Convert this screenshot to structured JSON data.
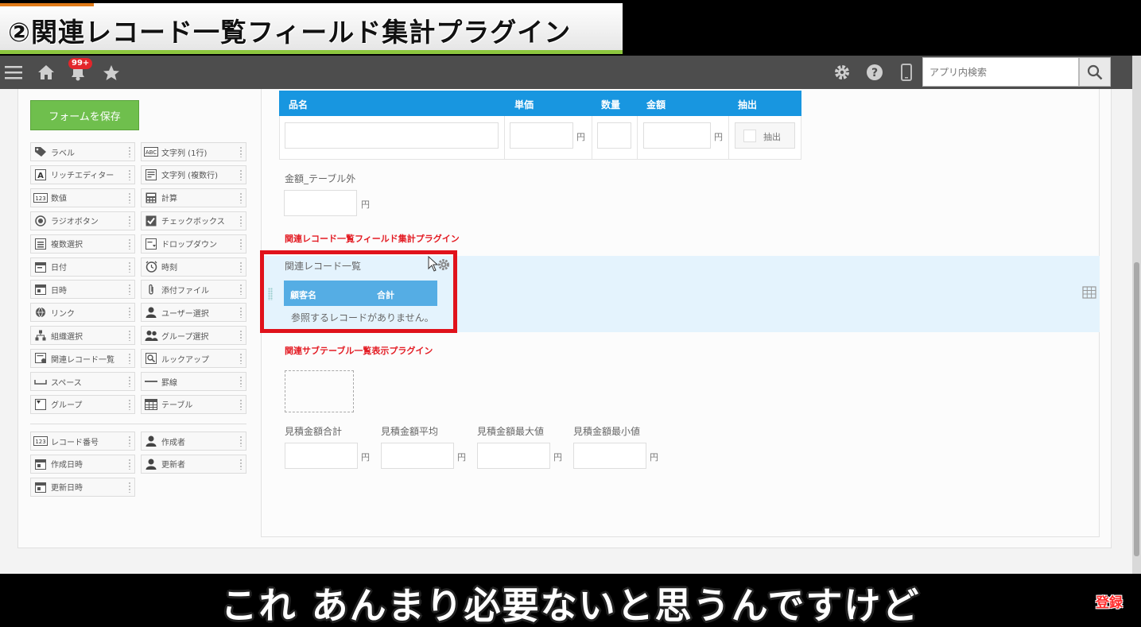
{
  "banner": {
    "title": "②関連レコード一覧フィールド集計プラグイン"
  },
  "navbar": {
    "badge": "99+",
    "search_placeholder": "アプリ内検索"
  },
  "palette": {
    "save_label": "フォームを保存",
    "left": [
      {
        "label": "ラベル",
        "icon": "tag-icon"
      },
      {
        "label": "リッチエディター",
        "icon": "rich-editor-icon"
      },
      {
        "label": "数値",
        "icon": "number-icon"
      },
      {
        "label": "ラジオボタン",
        "icon": "radio-icon"
      },
      {
        "label": "複数選択",
        "icon": "multi-select-icon"
      },
      {
        "label": "日付",
        "icon": "date-icon"
      },
      {
        "label": "日時",
        "icon": "datetime-icon"
      },
      {
        "label": "リンク",
        "icon": "link-icon"
      },
      {
        "label": "組織選択",
        "icon": "org-icon"
      },
      {
        "label": "関連レコード一覧",
        "icon": "related-records-icon"
      },
      {
        "label": "スペース",
        "icon": "space-icon"
      },
      {
        "label": "グループ",
        "icon": "group-icon"
      }
    ],
    "right": [
      {
        "label": "文字列 (1行)",
        "icon": "text-single-icon"
      },
      {
        "label": "文字列 (複数行)",
        "icon": "text-multi-icon"
      },
      {
        "label": "計算",
        "icon": "calc-icon"
      },
      {
        "label": "チェックボックス",
        "icon": "checkbox-icon"
      },
      {
        "label": "ドロップダウン",
        "icon": "dropdown-icon"
      },
      {
        "label": "時刻",
        "icon": "clock-icon"
      },
      {
        "label": "添付ファイル",
        "icon": "attachment-icon"
      },
      {
        "label": "ユーザー選択",
        "icon": "user-icon"
      },
      {
        "label": "グループ選択",
        "icon": "group-select-icon"
      },
      {
        "label": "ルックアップ",
        "icon": "lookup-icon"
      },
      {
        "label": "罫線",
        "icon": "line-icon"
      },
      {
        "label": "テーブル",
        "icon": "table-icon"
      }
    ],
    "system_left": [
      {
        "label": "レコード番号",
        "icon": "record-number-icon"
      },
      {
        "label": "作成日時",
        "icon": "created-at-icon"
      },
      {
        "label": "更新日時",
        "icon": "updated-at-icon"
      }
    ],
    "system_right": [
      {
        "label": "作成者",
        "icon": "creator-icon"
      },
      {
        "label": "更新者",
        "icon": "modifier-icon"
      }
    ]
  },
  "form": {
    "table": {
      "headers": {
        "name": "品名",
        "unit_price": "単価",
        "qty": "数量",
        "amount": "金額",
        "extract": "抽出"
      },
      "yen": "円",
      "checkbox_label": "抽出"
    },
    "outside_label": "金額_テーブル外",
    "yen": "円",
    "plugin1": "関連レコード一覧フィールド集計プラグイン",
    "related": {
      "title": "関連レコード一覧",
      "col1": "顧客名",
      "col2": "合計",
      "empty": "参照するレコードがありません。"
    },
    "plugin2": "関連サブテーブル一覧表示プラグイン",
    "estimates": [
      {
        "label": "見積金額合計"
      },
      {
        "label": "見積金額平均"
      },
      {
        "label": "見積金額最大値"
      },
      {
        "label": "見積金額最小値"
      }
    ]
  },
  "subtitle": "これ あんまり必要ないと思うんですけど",
  "subscribe": "登録"
}
